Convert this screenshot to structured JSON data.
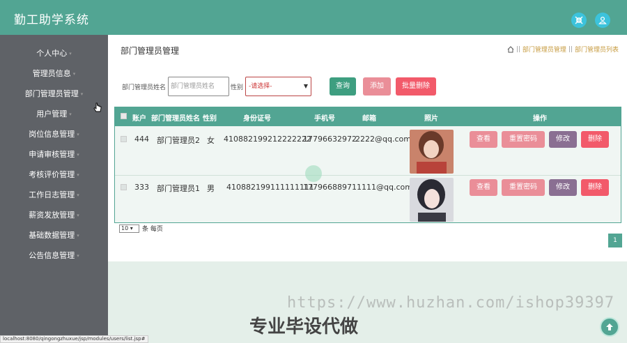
{
  "app": {
    "title": "勤工助学系统"
  },
  "topbar": {
    "icons": [
      "shrink-icon",
      "user-icon"
    ]
  },
  "sidebar": {
    "items": [
      {
        "label": "个人中心"
      },
      {
        "label": "管理员信息"
      },
      {
        "label": "部门管理员管理"
      },
      {
        "label": "用户管理"
      },
      {
        "label": "岗位信息管理"
      },
      {
        "label": "申请审核管理"
      },
      {
        "label": "考核评价管理"
      },
      {
        "label": "工作日志管理"
      },
      {
        "label": "薪资发放管理"
      },
      {
        "label": "基础数据管理"
      },
      {
        "label": "公告信息管理"
      }
    ]
  },
  "page": {
    "title": "部门管理员管理",
    "breadcrumb": {
      "sep": "||",
      "item1": "部门管理员管理",
      "item2": "部门管理员列表"
    }
  },
  "filter": {
    "name_label": "部门管理员姓名",
    "name_placeholder": "部门管理员姓名",
    "gender_label": "性别",
    "gender_selected": "-请选择-",
    "search_btn": "查询",
    "add_btn": "添加",
    "batch_delete_btn": "批量删除"
  },
  "table": {
    "headers": [
      "账户",
      "部门管理员姓名",
      "性别",
      "身份证号",
      "手机号",
      "邮箱",
      "照片",
      "操作"
    ],
    "rows": [
      {
        "account": "444",
        "name": "部门管理员2",
        "gender": "女",
        "id_card": "410882199212222222",
        "phone": "17796632972",
        "email": "2222@qq.com"
      },
      {
        "account": "333",
        "name": "部门管理员1",
        "gender": "男",
        "id_card": "410882199111111111",
        "phone": "17796688971",
        "email": "1111@qq.com"
      }
    ],
    "actions": {
      "view": "查看",
      "reset_pwd": "重置密码",
      "edit": "修改",
      "delete": "删除"
    }
  },
  "pager": {
    "per_page": "10",
    "per_page_label": "条 每页",
    "current_page": "1"
  },
  "watermark": {
    "url": "https://www.huzhan.com/ishop39397",
    "text": "专业毕设代做"
  },
  "status_bar": {
    "url": "localhost:8080/qingongzhuxue/jsp/modules/users/list.jsp#"
  },
  "colors": {
    "primary": "#52a593",
    "sidebar": "#5f6267",
    "view": "#ea8e98",
    "edit": "#8a6f92",
    "delete": "#f25a6a"
  }
}
